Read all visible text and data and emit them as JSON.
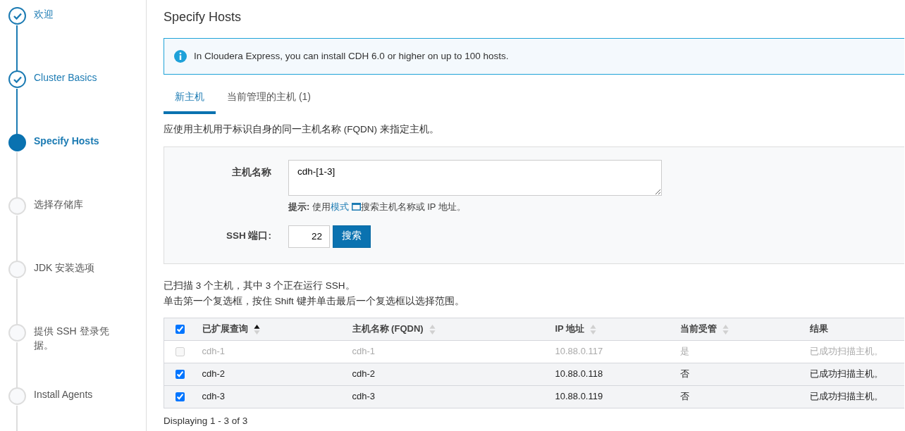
{
  "steps": [
    {
      "label": "欢迎",
      "completed": true,
      "selected": false
    },
    {
      "label": "Cluster Basics",
      "completed": true,
      "selected": false
    },
    {
      "label": "Specify Hosts",
      "completed": false,
      "selected": true
    },
    {
      "label": "选择存储库",
      "completed": false,
      "selected": false
    },
    {
      "label": "JDK 安装选项",
      "completed": false,
      "selected": false
    },
    {
      "label": "提供 SSH 登录凭据。",
      "completed": false,
      "selected": false
    },
    {
      "label": "Install Agents",
      "completed": false,
      "selected": false
    }
  ],
  "page_title": "Specify Hosts",
  "info_alert": "In Cloudera Express, you can install CDH 6.0 or higher on up to 100 hosts.",
  "tabs": [
    {
      "label": "新主机",
      "selected": true
    },
    {
      "label": "当前管理的主机 (1)",
      "selected": false
    }
  ],
  "description": "应使用主机用于标识自身的同一主机名称 (FQDN) 来指定主机。",
  "form": {
    "hostname_label": "主机名称",
    "hostname_value": "cdh-[1-3]",
    "hint": {
      "label": "提示:",
      "prefix": "使用",
      "link": "模式",
      "suffix": "搜索主机名称或 IP 地址。"
    },
    "ssh_port_label": "SSH 端口:",
    "ssh_port_value": "22",
    "search_button": "搜索"
  },
  "scan_summary": "已扫描 3 个主机，其中 3 个正在运行 SSH。",
  "selection_tip": "单击第一个复选框，按住 Shift 键并单击最后一个复选框以选择范围。",
  "table": {
    "select_all_checked": true,
    "columns": [
      {
        "label": "已扩展查询",
        "sortable": true,
        "sorted": true
      },
      {
        "label": "主机名称 (FQDN)",
        "sortable": true,
        "sorted": false
      },
      {
        "label": "IP 地址",
        "sortable": true,
        "sorted": false
      },
      {
        "label": "当前受管",
        "sortable": true,
        "sorted": false
      },
      {
        "label": "结果",
        "sortable": false
      }
    ],
    "rows": [
      {
        "checked": false,
        "disabled": true,
        "cells": [
          "cdh-1",
          "cdh-1",
          "10.88.0.117",
          "是",
          "已成功扫描主机。"
        ]
      },
      {
        "checked": true,
        "disabled": false,
        "cells": [
          "cdh-2",
          "cdh-2",
          "10.88.0.118",
          "否",
          "已成功扫描主机。"
        ]
      },
      {
        "checked": true,
        "disabled": false,
        "cells": [
          "cdh-3",
          "cdh-3",
          "10.88.0.119",
          "否",
          "已成功扫描主机。"
        ]
      }
    ]
  },
  "pagination": "Displaying 1 - 3 of 3"
}
